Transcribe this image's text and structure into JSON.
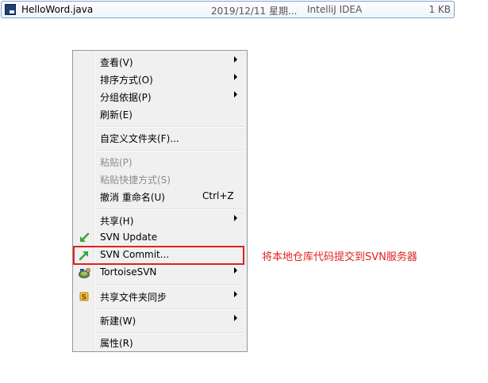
{
  "file_row": {
    "name": "HelloWord.java",
    "date": "2019/12/11 星期...",
    "type": "IntelliJ IDEA",
    "size": "1 KB",
    "icon": "java-file-icon"
  },
  "menu": {
    "items": [
      {
        "label": "查看(V)",
        "submenu": true
      },
      {
        "label": "排序方式(O)",
        "submenu": true
      },
      {
        "label": "分组依据(P)",
        "submenu": true
      },
      {
        "label": "刷新(E)"
      },
      {
        "label": "自定义文件夹(F)..."
      },
      {
        "label": "粘贴(P)",
        "disabled": true
      },
      {
        "label": "粘贴快捷方式(S)",
        "disabled": true
      },
      {
        "label": "撤消 重命名(U)",
        "shortcut": "Ctrl+Z"
      },
      {
        "label": "共享(H)",
        "submenu": true
      },
      {
        "label": "SVN Update",
        "icon": "svn-update-icon"
      },
      {
        "label": "SVN Commit...",
        "icon": "svn-commit-icon"
      },
      {
        "label": "TortoiseSVN",
        "icon": "tortoisesvn-icon",
        "submenu": true
      },
      {
        "label": "共享文件夹同步",
        "icon": "folder-sync-icon",
        "submenu": true
      },
      {
        "label": "新建(W)",
        "submenu": true
      },
      {
        "label": "属性(R)"
      }
    ]
  },
  "annotation": {
    "text": "将本地仓库代码提交到SVN服务器",
    "color": "#e02020"
  },
  "colors": {
    "menu_bg": "#f0f0f0",
    "menu_border": "#979797",
    "disabled_text": "#8d8d8d",
    "highlight": "#e02020",
    "selection_border": "#7da2ce"
  }
}
